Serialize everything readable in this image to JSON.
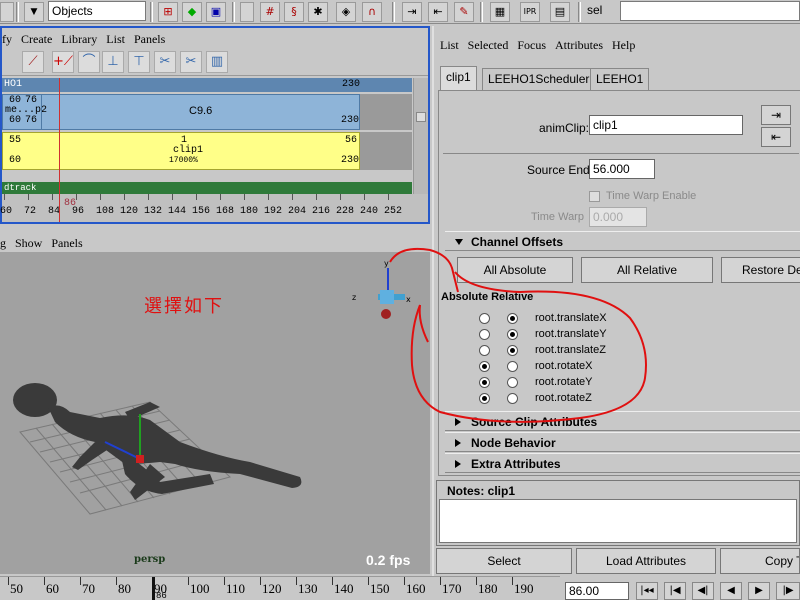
{
  "toolbar": {
    "selection_mode": "Objects",
    "selected_node": "sel"
  },
  "trax": {
    "menu": [
      "fy",
      "Create",
      "Library",
      "List",
      "Panels"
    ],
    "track_header": {
      "label": "HO1",
      "end": "230"
    },
    "blue_clip": {
      "start_a": "60",
      "start_b": "76",
      "mid_label": "me...p2",
      "start_c": "60",
      "start_d": "76",
      "title": "C9.6",
      "end": "230"
    },
    "yellow_clip": {
      "start": "55",
      "end_top": "56",
      "mark": "1",
      "name": "clip1",
      "start_bottom": "60",
      "scale": "17000%",
      "end_bottom": "230"
    },
    "green_track": "dtrack",
    "current_frame": "86",
    "ruler": [
      "60",
      "72",
      "84",
      "96",
      "108",
      "120",
      "132",
      "144",
      "156",
      "168",
      "180",
      "192",
      "204",
      "216",
      "228",
      "240",
      "252"
    ]
  },
  "viewport": {
    "menu": [
      "g",
      "Show",
      "Panels"
    ],
    "annotation": "選擇如下",
    "camera": "persp",
    "fps": "0.2 fps"
  },
  "attr_editor": {
    "menu": [
      "List",
      "Selected",
      "Focus",
      "Attributes",
      "Help"
    ],
    "tabs": [
      "clip1",
      "LEEHO1Scheduler1",
      "LEEHO1"
    ],
    "anim_clip_label": "animClip:",
    "anim_clip_value": "clip1",
    "source_end_label": "Source End",
    "source_end_value": "56.000",
    "time_warp_enable": "Time Warp Enable",
    "time_warp_label": "Time Warp",
    "time_warp_value": "0.000",
    "channel_offsets": {
      "title": "Channel Offsets",
      "buttons": [
        "All Absolute",
        "All Relative",
        "Restore Defa"
      ],
      "header": "Absolute Relative",
      "rows": [
        {
          "name": "root.translateX",
          "absolute": false
        },
        {
          "name": "root.translateY",
          "absolute": false
        },
        {
          "name": "root.translateZ",
          "absolute": false
        },
        {
          "name": "root.rotateX",
          "absolute": true
        },
        {
          "name": "root.rotateY",
          "absolute": true
        },
        {
          "name": "root.rotateZ",
          "absolute": true
        }
      ]
    },
    "sections": [
      "Source Clip Attributes",
      "Node Behavior",
      "Extra Attributes"
    ],
    "notes_title": "Notes: clip1",
    "bottom_buttons": [
      "Select",
      "Load Attributes",
      "Copy Ta"
    ]
  },
  "timeline": {
    "ticks": [
      "50",
      "60",
      "70",
      "80",
      "90",
      "100",
      "110",
      "120",
      "130",
      "140",
      "150",
      "160",
      "170",
      "180",
      "190"
    ],
    "current_frame_mark": "86",
    "current_time": "86.00"
  },
  "colors": {
    "trax_border": "#2457c9",
    "blue_clip": "#8eb4d8",
    "yellow_clip": "#ffff88",
    "green_track": "#2f7a3a",
    "annotation": "#e01010"
  }
}
